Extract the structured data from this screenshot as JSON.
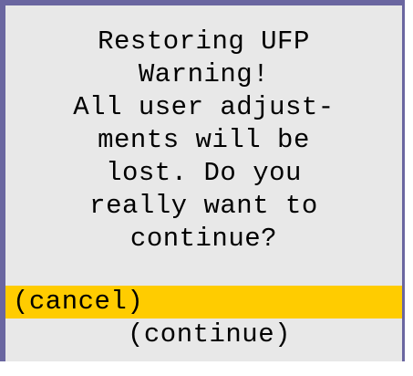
{
  "dialog": {
    "title_lines": [
      "Restoring UFP",
      "Warning!"
    ],
    "message_lines": [
      "All user adjust-",
      "ments will be",
      "lost. Do you",
      "really want to",
      "continue?"
    ],
    "options": [
      {
        "label": "(cancel)",
        "selected": true
      },
      {
        "label": "(continue)",
        "selected": false
      }
    ]
  },
  "colors": {
    "background": "#e8e8e8",
    "border": "#6a66a0",
    "highlight": "#ffcc00",
    "text": "#000000"
  }
}
